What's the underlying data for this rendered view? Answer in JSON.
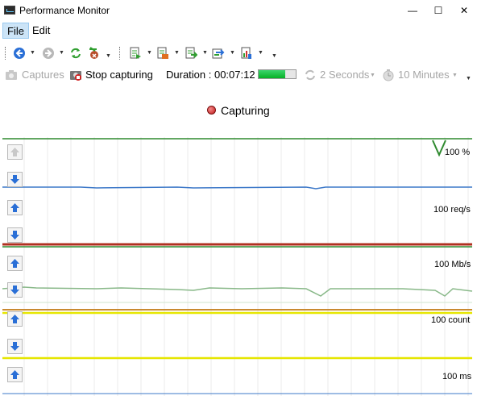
{
  "window": {
    "title": "Performance Monitor",
    "minimize": "—",
    "maximize": "☐",
    "close": "✕"
  },
  "menu": {
    "file": "File",
    "edit": "Edit"
  },
  "toolbar": {
    "icons": [
      "back-icon",
      "forward-icon",
      "refresh-icon",
      "clear-icon",
      "overflow-icon",
      "export-icon",
      "export-xml-icon",
      "copy-icon",
      "save-icon",
      "report-icon",
      "overflow-icon"
    ]
  },
  "capture_bar": {
    "captures_label": "Captures",
    "stop_label": "Stop capturing",
    "duration_label": "Duration : 00:07:12",
    "progress_fraction": 0.72,
    "interval_label": "2 Seconds",
    "window_label": "10 Minutes"
  },
  "status": {
    "text": "Capturing",
    "dot_color": "#d02020"
  },
  "charts": [
    {
      "scale": "100 %",
      "line_color": "#3c78c8"
    },
    {
      "scale": "100 req/s",
      "line_color": "#b03020"
    },
    {
      "scale": "100 Mb/s",
      "line_color": "#88b888"
    },
    {
      "scale": "100 count",
      "line_color": "#e6e600"
    },
    {
      "scale": "100 ms",
      "line_color": "#3c78c8"
    }
  ]
}
